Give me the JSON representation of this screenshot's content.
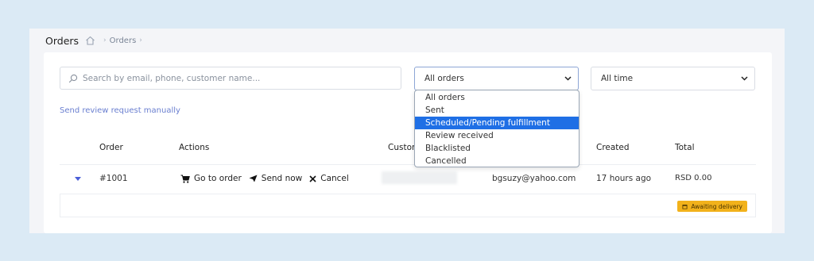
{
  "header": {
    "title": "Orders",
    "breadcrumb": [
      "Orders"
    ]
  },
  "filters": {
    "search_placeholder": "Search by email, phone, customer name...",
    "status_selected": "All orders",
    "time_selected": "All time",
    "status_options": [
      "All orders",
      "Sent",
      "Scheduled/Pending fulfillment",
      "Review received",
      "Blacklisted",
      "Cancelled"
    ],
    "highlighted_option": "Scheduled/Pending fulfillment"
  },
  "manual_link": "Send review request manually",
  "table": {
    "columns": [
      "Order",
      "Actions",
      "Custom",
      "Created",
      "Total"
    ],
    "rows": [
      {
        "order": "#1001",
        "actions": [
          "Go to order",
          "Send now",
          "Cancel"
        ],
        "email": "bgsuzy@yahoo.com",
        "created": "17 hours ago",
        "total": "RSD 0.00",
        "status": "Awaiting delivery"
      }
    ]
  },
  "colors": {
    "accent": "#4a5ed8",
    "link": "#6a7fd0",
    "highlight": "#1f6fe5",
    "badge": "#f2b21b"
  }
}
